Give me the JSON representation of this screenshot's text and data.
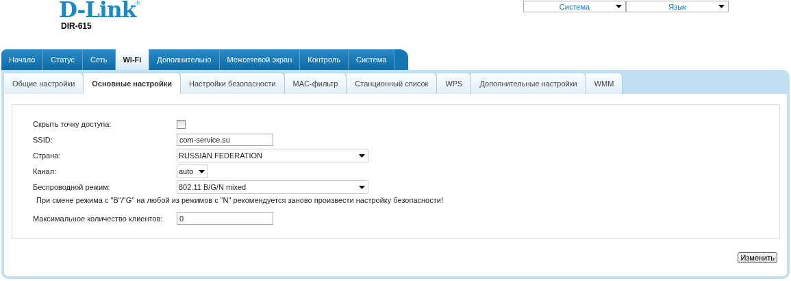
{
  "header": {
    "logo": "D-Link",
    "logo_mark": "®",
    "model": "DIR-615",
    "menus": [
      {
        "label": "Система"
      },
      {
        "label": "Язык"
      }
    ]
  },
  "main_tabs": [
    {
      "label": "Начало",
      "selected": false
    },
    {
      "label": "Статус",
      "selected": false
    },
    {
      "label": "Сеть",
      "selected": false
    },
    {
      "label": "Wi-Fi",
      "selected": true
    },
    {
      "label": "Дополнительно",
      "selected": false
    },
    {
      "label": "Межсетевой экран",
      "selected": false
    },
    {
      "label": "Контроль",
      "selected": false
    },
    {
      "label": "Система",
      "selected": false
    }
  ],
  "sub_tabs": [
    {
      "label": "Общие настройки",
      "selected": false
    },
    {
      "label": "Основные настройки",
      "selected": true
    },
    {
      "label": "Настройки безопасности",
      "selected": false
    },
    {
      "label": "MAC-фильтр",
      "selected": false
    },
    {
      "label": "Станционный список",
      "selected": false
    },
    {
      "label": "WPS",
      "selected": false
    },
    {
      "label": "Дополнительные настройки",
      "selected": false
    },
    {
      "label": "WMM",
      "selected": false
    }
  ],
  "form": [
    {
      "kind": "checkbox",
      "label": "Скрыть точку доступа:",
      "checked": false
    },
    {
      "kind": "text",
      "label": "SSID:",
      "value": "com-service.su"
    },
    {
      "kind": "select",
      "label": "Страна:",
      "value": "RUSSIAN FEDERATION"
    },
    {
      "kind": "select",
      "label": "Канал:",
      "value": "auto"
    },
    {
      "kind": "select",
      "label": "Беспроводной режим:",
      "value": "802.11 B/G/N mixed"
    },
    {
      "kind": "note",
      "label": "При смене режима с \"B\"/\"G\" на любой из режимов с \"N\" рекомендуется заново произвести настройку безопасности!"
    },
    {
      "kind": "text",
      "label": "Максимальное количество клиентов:",
      "value": "0"
    }
  ],
  "buttons": [
    {
      "label": "Изменить"
    }
  ]
}
